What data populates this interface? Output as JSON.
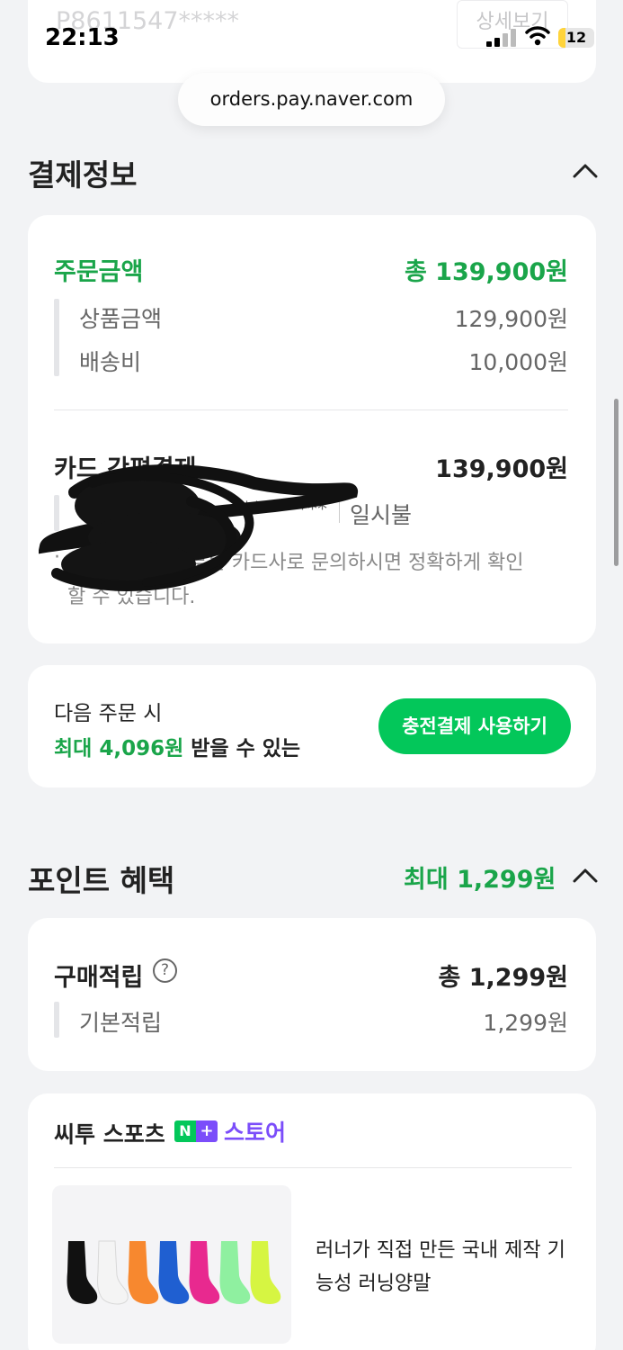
{
  "status_bar": {
    "time": "22:13",
    "battery": "12"
  },
  "top_card": {
    "order_no": "P8611547*****",
    "detail_button": "상세보기"
  },
  "url_pill": "orders.pay.naver.com",
  "payment_section": {
    "title": "결제정보",
    "order_amount_label": "주문금액",
    "order_amount_value": "총 139,900원",
    "product_label": "상품금액",
    "product_value": "129,900원",
    "shipping_label": "배송비",
    "shipping_value": "10,000원",
    "card_label": "카드 간편결제",
    "card_value": "139,900원",
    "card_mask": "**** ****",
    "installment": "일시불",
    "notice_line1": "무이자 적용 여부는 카드사로 문의하시면 정확하게 확인",
    "notice_line2": "할 수 있습니다."
  },
  "promo": {
    "line1": "다음 주문 시",
    "line2_green": "최대 4,096원",
    "line2_rest": "받을 수 있는",
    "button": "충전결제 사용하기"
  },
  "points_section": {
    "title": "포인트 혜택",
    "max_label": "최대 1,299원",
    "purchase_label": "구매적립",
    "purchase_value": "총 1,299원",
    "basic_label": "기본적립",
    "basic_value": "1,299원"
  },
  "store": {
    "name": "씨투 스포츠",
    "badge_n": "N",
    "badge_plus": "+",
    "badge_store": "스토어",
    "product_line1": "러너가 직접 만든 국내 제작 기",
    "product_line2": "능성 러닝양말",
    "sock_colors": [
      "#111111",
      "#f4f4f4",
      "#f7882f",
      "#1f5fd1",
      "#e8298f",
      "#8ff0a0",
      "#d6f542"
    ]
  },
  "colors": {
    "accent_green": "#1aa54a",
    "badge_green": "#03c75a",
    "badge_purple": "#7b4dfa"
  }
}
